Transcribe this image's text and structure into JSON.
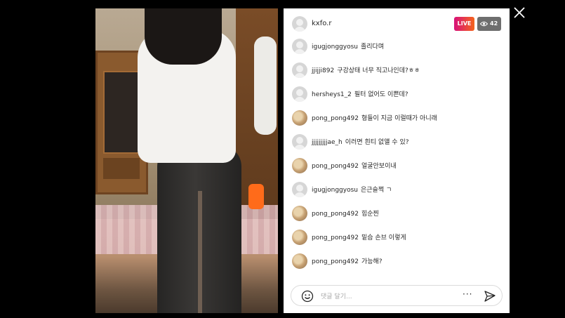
{
  "stream": {
    "host_username": "kxfo.r",
    "live_label": "LIVE",
    "viewer_count": "42"
  },
  "comments": [
    {
      "user": "igugjonggyosu",
      "text": "졸리다며",
      "avatar": "gray"
    },
    {
      "user": "jjijji892",
      "text": "구강상태 너무 직고나인데?ㅎㅎ",
      "avatar": "gray"
    },
    {
      "user": "hersheys1_2",
      "text": "필터 없어도 이쁜데?",
      "avatar": "gray"
    },
    {
      "user": "pong_pong492",
      "text": "형들이 지금 이럴때가 아니래",
      "avatar": "photo"
    },
    {
      "user": "jjjjjjjjjae_h",
      "text": "이러면 흰티 없앨 수 있?",
      "avatar": "gray"
    },
    {
      "user": "pong_pong492",
      "text": "얼굴안보이내",
      "avatar": "photo"
    },
    {
      "user": "igugjonggyosu",
      "text": "은근슬쩍 ㄱ",
      "avatar": "gray"
    },
    {
      "user": "pong_pong492",
      "text": "힘순찐",
      "avatar": "photo"
    },
    {
      "user": "pong_pong492",
      "text": "밑슴 손브 이렇게",
      "avatar": "photo"
    },
    {
      "user": "pong_pong492",
      "text": "가능해?",
      "avatar": "photo"
    }
  ],
  "input": {
    "placeholder": "댓글 달기...",
    "more_label": "···"
  },
  "icons": {
    "close": "close-icon",
    "viewers": "eye-icon",
    "emoji": "emoji-icon",
    "send": "send-icon"
  },
  "colors": {
    "live_gradient_start": "#d7127a",
    "live_gradient_end": "#f5651c",
    "viewer_badge": "#6e6e6e"
  }
}
